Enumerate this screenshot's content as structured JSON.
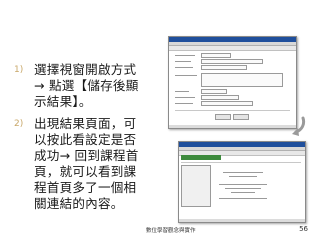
{
  "steps": [
    {
      "num": "1)",
      "lines": [
        "選擇視窗開啟方式",
        "→ 點選【儲存後顯",
        "示結果】。"
      ]
    },
    {
      "num": "2)",
      "lines": [
        "出現結果頁面，可",
        "以按此看設定是否",
        "成功→ 回到課程首",
        "頁，就可以看到課",
        "程首頁多了一個相",
        "關連結的內容。"
      ]
    }
  ],
  "footer": {
    "title": "數位學習觀念與實作",
    "page": "56"
  },
  "icons": {
    "arrow": "curved-arrow-icon"
  },
  "colors": {
    "accent": "#1f4f9c",
    "step_number": "#c9a86a",
    "arrow": "#9a9a9a"
  }
}
